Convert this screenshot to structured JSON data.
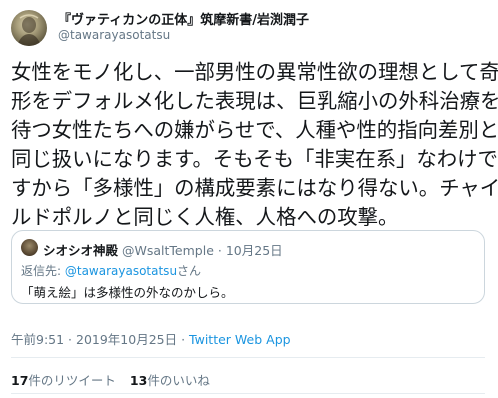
{
  "author": {
    "display_name": "『ヴァティカンの正体』筑摩新書/岩渕潤子",
    "handle": "@tawarayasotatsu",
    "avatar_icon": "profile-photo-avatar"
  },
  "tweet": {
    "lines": [
      "女性をモノ化し、一部男性の異常性欲の理想として奇",
      "形をデフォルメ化した表現は、巨乳縮小の外科治療を",
      "待つ女性たちへの嫌がらせで、人種や性的指向差別と",
      "同じ扱いになります。そもそも「非実在系」なわけで",
      "すから「多様性」の構成要素にはなり得ない。チャイ",
      "ルドポルノと同じく人権、人格への攻撃。"
    ]
  },
  "quote": {
    "name": "シオシオ神殿",
    "handle": "@WsaltTemple",
    "separator": "·",
    "date": "10月25日",
    "reply_prefix": "返信先: ",
    "reply_to": "@tawarayasotatsu",
    "reply_suffix": "さん",
    "text": "「萌え絵」は多様性の外なのかしら。"
  },
  "meta": {
    "time": "午前9:51",
    "separator": " · ",
    "date": "2019年10月25日",
    "app": "Twitter Web App"
  },
  "stats": {
    "retweets_count": "17",
    "retweets_label": "件のリツイート",
    "likes_count": "13",
    "likes_label": "件のいいね"
  },
  "colors": {
    "link": "#1b95e0",
    "secondary_text": "#657786",
    "border": "#ccd6dd"
  }
}
